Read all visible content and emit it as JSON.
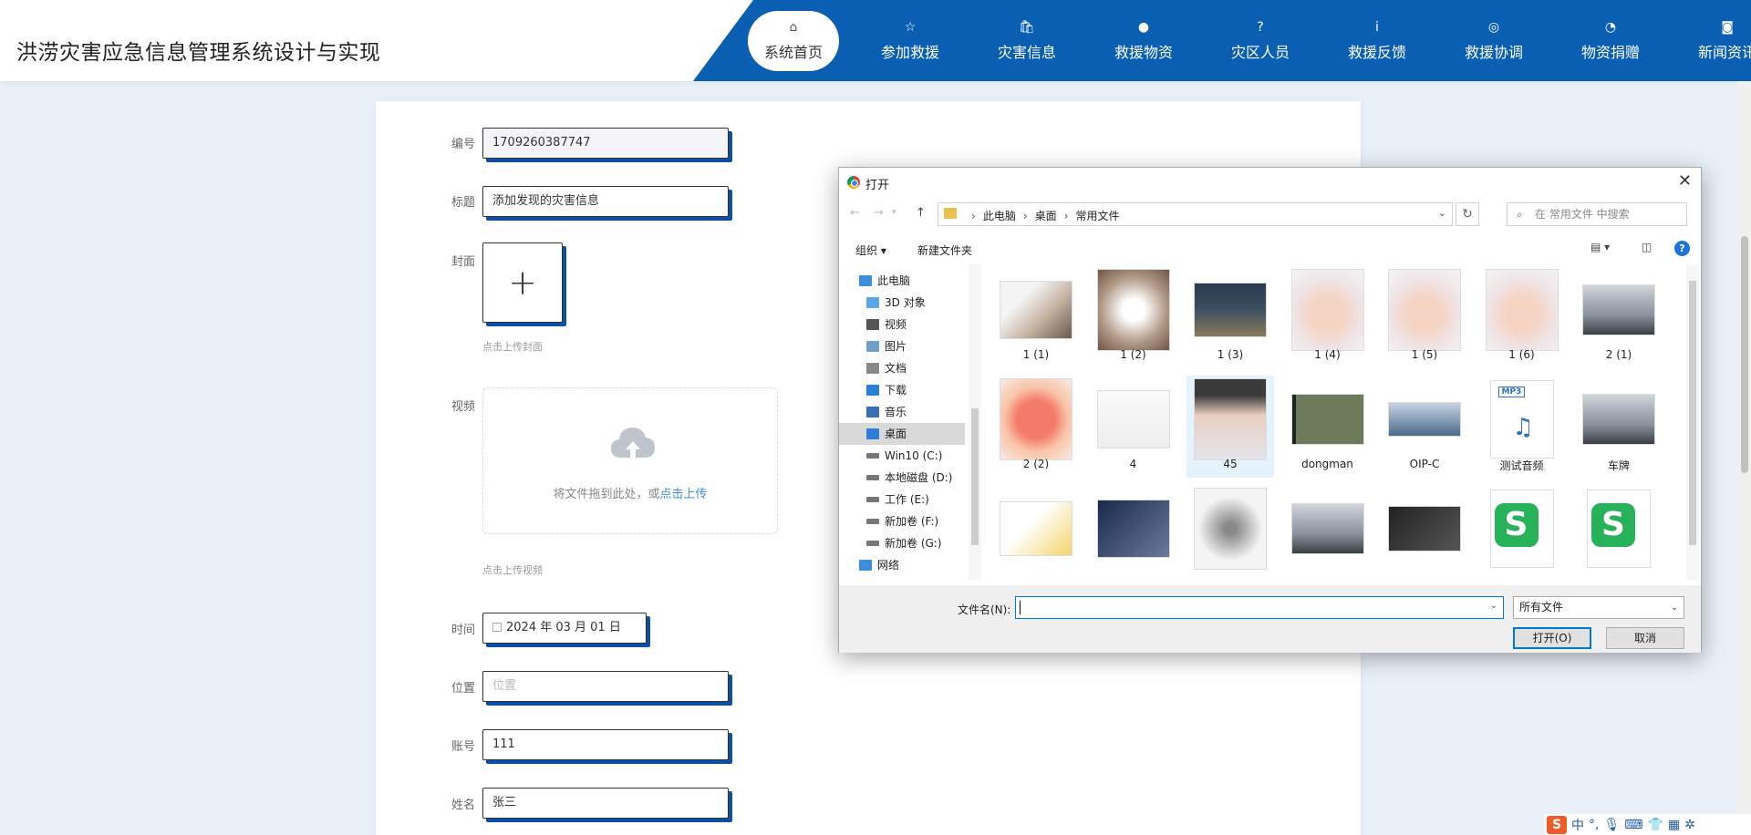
{
  "header": {
    "title": "洪涝灾害应急信息管理系统设计与实现",
    "nav": [
      {
        "label": "系统首页",
        "icon": "home-icon",
        "active": true
      },
      {
        "label": "参加救援",
        "icon": "star-icon"
      },
      {
        "label": "灾害信息",
        "icon": "bag-icon"
      },
      {
        "label": "救援物资",
        "icon": "alert-icon"
      },
      {
        "label": "灾区人员",
        "icon": "question-icon"
      },
      {
        "label": "救援反馈",
        "icon": "info-icon"
      },
      {
        "label": "救援协调",
        "icon": "target-icon"
      },
      {
        "label": "物资捐赠",
        "icon": "gauge-icon"
      },
      {
        "label": "新闻资讯",
        "icon": "camera-icon"
      }
    ],
    "nav_color": "#0a5fb3"
  },
  "form": {
    "id_label": "编号",
    "id_value": "1709260387747",
    "title_label": "标题",
    "title_value": "添加发现的灾害信息",
    "cover_label": "封面",
    "cover_plus": "+",
    "cover_hint": "点击上传封面",
    "video_label": "视频",
    "video_drag_text": "将文件拖到此处，或",
    "video_drag_link": "点击上传",
    "video_hint": "点击上传视频",
    "time_label": "时间",
    "time_value": "2024 年 03 月 01 日",
    "location_label": "位置",
    "location_placeholder": "位置",
    "account_label": "账号",
    "account_value": "111",
    "name_label": "姓名",
    "name_value": "张三"
  },
  "dialog": {
    "title": "打开",
    "close": "✕",
    "breadcrumb": [
      "此电脑",
      "桌面",
      "常用文件"
    ],
    "search_placeholder": "在 常用文件 中搜索",
    "toolbar": {
      "organize": "组织 ▾",
      "new_folder": "新建文件夹"
    },
    "tree": [
      {
        "label": "此电脑",
        "icon": "computer-icon",
        "indent": 0
      },
      {
        "label": "3D 对象",
        "icon": "cube-icon",
        "indent": 1
      },
      {
        "label": "视频",
        "icon": "film-icon",
        "indent": 1
      },
      {
        "label": "图片",
        "icon": "picture-icon",
        "indent": 1
      },
      {
        "label": "文档",
        "icon": "document-icon",
        "indent": 1
      },
      {
        "label": "下载",
        "icon": "download-icon",
        "indent": 1
      },
      {
        "label": "音乐",
        "icon": "music-icon",
        "indent": 1
      },
      {
        "label": "桌面",
        "icon": "desktop-icon",
        "indent": 1,
        "selected": true
      },
      {
        "label": "Win10 (C:)",
        "icon": "drive-icon",
        "indent": 1
      },
      {
        "label": "本地磁盘 (D:)",
        "icon": "drive-icon",
        "indent": 1
      },
      {
        "label": "工作 (E:)",
        "icon": "drive-icon",
        "indent": 1
      },
      {
        "label": "新加卷 (F:)",
        "icon": "drive-icon",
        "indent": 1
      },
      {
        "label": "新加卷 (G:)",
        "icon": "drive-icon",
        "indent": 1
      },
      {
        "label": "网络",
        "icon": "network-icon",
        "indent": 0
      }
    ],
    "files": [
      {
        "name": "1 (1)",
        "kind": "cat-photo"
      },
      {
        "name": "1 (2)",
        "kind": "teaset-photo"
      },
      {
        "name": "1 (3)",
        "kind": "house-photo"
      },
      {
        "name": "1 (4)",
        "kind": "baby-photo"
      },
      {
        "name": "1 (5)",
        "kind": "baby-photo"
      },
      {
        "name": "1 (6)",
        "kind": "baby-photo"
      },
      {
        "name": "2 (1)",
        "kind": "car-photo"
      },
      {
        "name": "2 (2)",
        "kind": "peach-photo"
      },
      {
        "name": "4",
        "kind": "document-photo"
      },
      {
        "name": "45",
        "kind": "girl-photo",
        "hover": true
      },
      {
        "name": "dongman",
        "kind": "video-file"
      },
      {
        "name": "OIP-C",
        "kind": "building-photo"
      },
      {
        "name": "测试音频",
        "kind": "mp3-file"
      },
      {
        "name": "车牌",
        "kind": "car-photo"
      },
      {
        "name": "",
        "kind": "cartoon-photo"
      },
      {
        "name": "",
        "kind": "book-photo"
      },
      {
        "name": "",
        "kind": "deer-sketch"
      },
      {
        "name": "",
        "kind": "car-photo"
      },
      {
        "name": "",
        "kind": "gpu-photo"
      },
      {
        "name": "",
        "kind": "wps-file"
      },
      {
        "name": "",
        "kind": "wps-file"
      }
    ],
    "filename_label": "文件名(N):",
    "filename_value": "",
    "filetype": "所有文件",
    "open_button": "打开(O)",
    "cancel_button": "取消"
  },
  "ime": {
    "logo": "S",
    "lang": "中"
  }
}
